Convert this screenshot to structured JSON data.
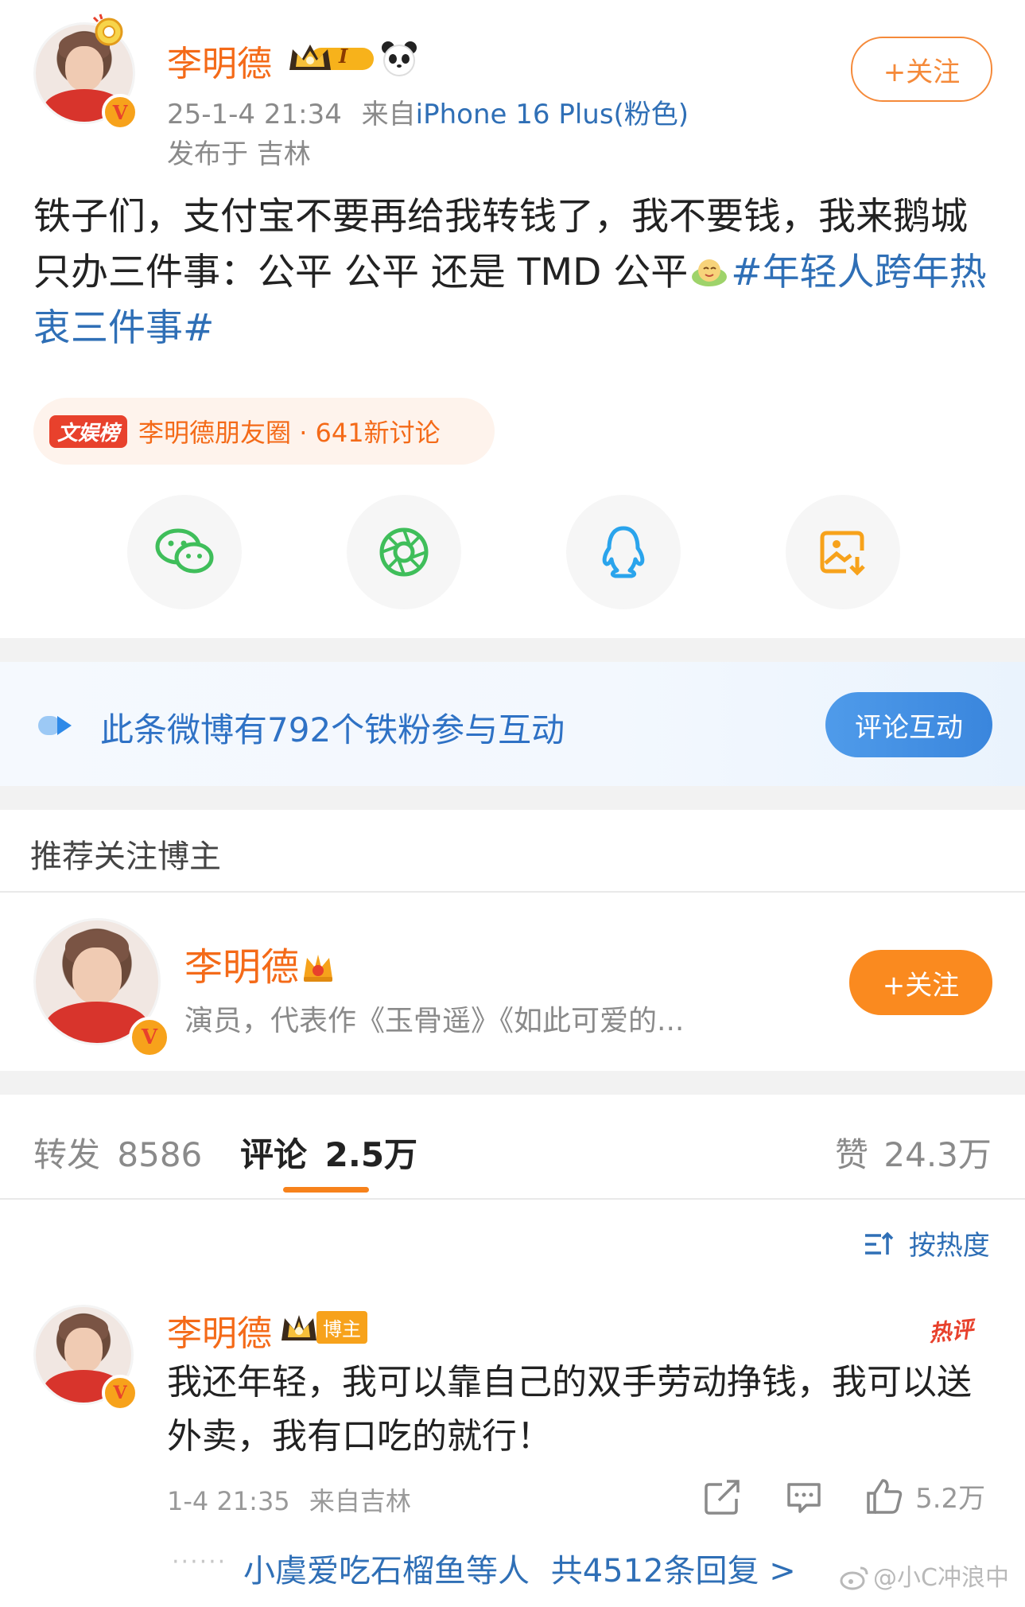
{
  "post": {
    "author": "李明德",
    "level_badge": "I",
    "timestamp": "25-1-4 21:34",
    "source_prefix": "来自",
    "source_device": "iPhone 16 Plus(粉色)",
    "location": "发布于 吉林",
    "follow_label": "+关注",
    "text_main": "铁子们，支付宝不要再给我转钱了，我不要钱，我来鹅城只办三件事：公平 公平 还是 TMD 公平",
    "topic": "#年轻人跨年热衷三件事#",
    "chip_tag": "文娱榜",
    "chip_text": "李明德朋友圈 · 641新讨论"
  },
  "share": {
    "items": [
      {
        "name": "wechat-icon",
        "color": "#3fbe5a"
      },
      {
        "name": "moments-icon",
        "color": "#3fbe5a"
      },
      {
        "name": "qq-icon",
        "color": "#2aa4ec"
      },
      {
        "name": "save-image-icon",
        "color": "#f7a21b"
      }
    ]
  },
  "fans": {
    "text": "此条微博有792个铁粉参与互动",
    "button": "评论互动"
  },
  "recommend": {
    "heading": "推荐关注博主",
    "name": "李明德",
    "desc": "演员，代表作《玉骨遥》《如此可爱的...",
    "follow_label": "+关注"
  },
  "stats": {
    "repost_label": "转发",
    "repost_count": "8586",
    "comment_label": "评论",
    "comment_count": "2.5万",
    "like_label": "赞",
    "like_count": "24.3万"
  },
  "sort_label": "按热度",
  "comment": {
    "author": "李明德",
    "role_badge": "博主",
    "hot_badge": "热评",
    "text": "我还年轻，我可以靠自己的双手劳动挣钱，我可以送外卖，我有口吃的就行！",
    "time": "1-4 21:35",
    "location": "来自吉林",
    "likes": "5.2万",
    "replies_prefix": "小虞爱吃石榴鱼等人",
    "replies_count": "共4512条回复 >"
  },
  "watermark": "@小C冲浪中",
  "colors": {
    "brand_orange": "#f46a18",
    "link_blue": "#2f6fb6",
    "button_blue": "#3a86dd"
  }
}
